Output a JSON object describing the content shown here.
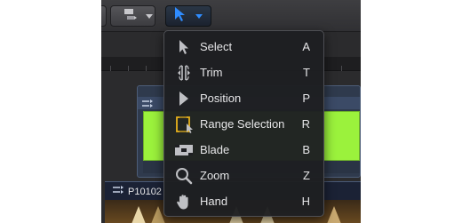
{
  "bottom_clip": {
    "name": "P10102"
  },
  "tool_menu": {
    "items": [
      {
        "icon": "select-arrow-icon",
        "label": "Select",
        "shortcut": "A"
      },
      {
        "icon": "trim-icon",
        "label": "Trim",
        "shortcut": "T"
      },
      {
        "icon": "position-icon",
        "label": "Position",
        "shortcut": "P"
      },
      {
        "icon": "range-selection-icon",
        "label": "Range Selection",
        "shortcut": "R"
      },
      {
        "icon": "blade-icon",
        "label": "Blade",
        "shortcut": "B"
      },
      {
        "icon": "zoom-icon",
        "label": "Zoom",
        "shortcut": "Z"
      },
      {
        "icon": "hand-icon",
        "label": "Hand",
        "shortcut": "H"
      }
    ]
  },
  "colors": {
    "active_tool_blue": "#2f8cff",
    "clip_green": "#9bf23c",
    "range_selection_yellow": "#e8b21c"
  }
}
